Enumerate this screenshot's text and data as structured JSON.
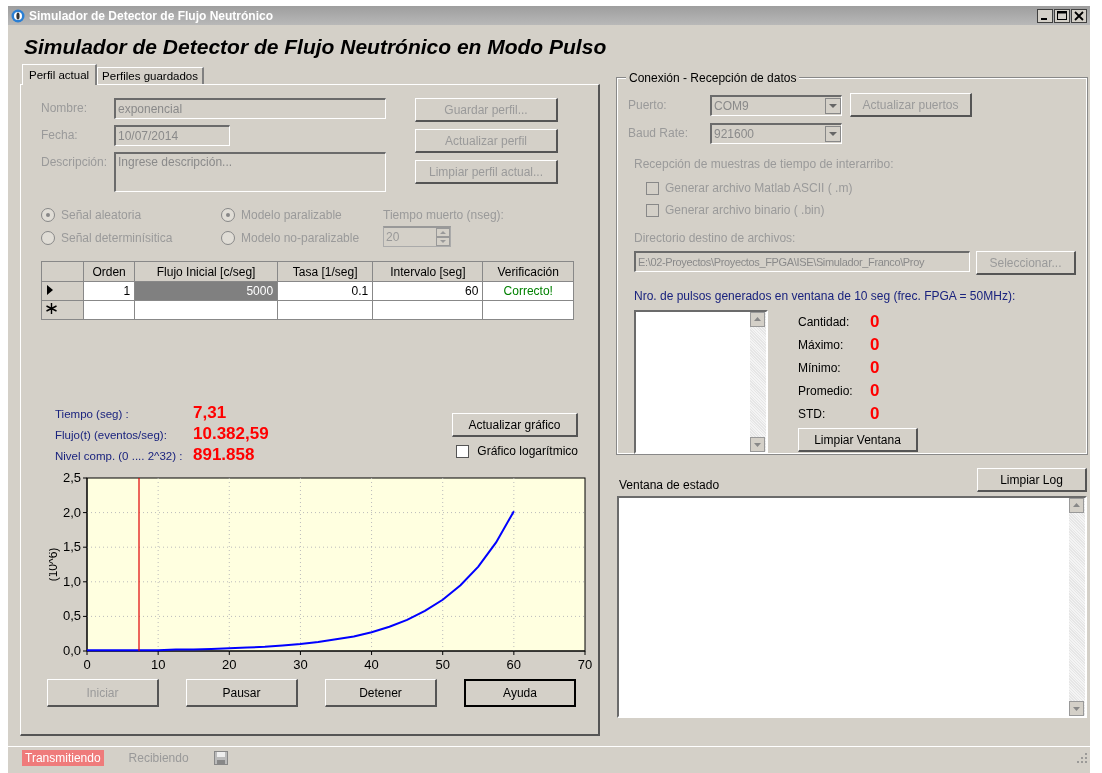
{
  "window": {
    "title": "Simulador de Detector de Flujo Neutrónico"
  },
  "heading": "Simulador de Detector de Flujo Neutrónico en Modo Pulso",
  "tabs": [
    {
      "label": "Perfil actual",
      "selected": true
    },
    {
      "label": "Perfiles guardados",
      "selected": false
    }
  ],
  "profile": {
    "disabled": true,
    "fields": [
      {
        "kind": "text",
        "label": "Nombre:",
        "value": "exponencial"
      },
      {
        "kind": "short",
        "label": "Fecha:",
        "value": "10/07/2014"
      },
      {
        "kind": "multiline",
        "label": "Descripción:",
        "placeholder": "Ingrese descripción..."
      }
    ],
    "buttons": [
      {
        "label": "Guardar perfil...",
        "disabled": true
      },
      {
        "label": "Actualizar perfil",
        "disabled": true
      },
      {
        "label": "Limpiar perfil actual...",
        "disabled": true
      }
    ]
  },
  "signal_options": [
    {
      "label": "Señal aleatoria",
      "selected": true,
      "disabled": true
    },
    {
      "label": "Señal determinísitica",
      "selected": false,
      "disabled": true
    }
  ],
  "model_options": [
    {
      "label": "Modelo paralizable",
      "selected": true,
      "disabled": true
    },
    {
      "label": "Modelo no-paralizable",
      "selected": false,
      "disabled": true
    }
  ],
  "dead_time": {
    "label": "Tiempo muerto (nseg):",
    "value": "20",
    "disabled": true
  },
  "table": {
    "columns": [
      "Orden",
      "Flujo Inicial [c/seg]",
      "Tasa [1/seg]",
      "Intervalo [seg]",
      "Verificación"
    ],
    "rows": [
      {
        "kind": "current",
        "cells": [
          {
            "text": "1",
            "selected": false
          },
          {
            "text": "5000",
            "selected": true
          },
          {
            "text": "0.1",
            "selected": false
          },
          {
            "text": "60",
            "selected": false
          },
          {
            "text": "Correcto!",
            "selected": false
          }
        ]
      },
      {
        "kind": "new",
        "cells": []
      }
    ]
  },
  "readouts": [
    {
      "label": "Tiempo (seg) :",
      "value": "7,31"
    },
    {
      "label": "Flujo(t) (eventos/seg):",
      "value": "10.382,59"
    },
    {
      "label": "Nivel comp. (0 .... 2^32) :",
      "value": "891.858"
    }
  ],
  "update_chart_button": {
    "label": "Actualizar gráfico"
  },
  "log_scale": {
    "label": "Gráfico logarítmico",
    "checked": false
  },
  "chart_data": {
    "type": "line",
    "ylabel": "(10^6)",
    "grid": true,
    "x": [
      0,
      2.5,
      5,
      7.5,
      10,
      12.5,
      15,
      17.5,
      20,
      22.5,
      25,
      27.5,
      30,
      32.5,
      35,
      37.5,
      40,
      42.5,
      45,
      47.5,
      50,
      52.5,
      55,
      57.5,
      60
    ],
    "series": [
      {
        "color": "#0000ff",
        "values": [
          0.01,
          0.01,
          0.01,
          0.01,
          0.01,
          0.02,
          0.02,
          0.03,
          0.04,
          0.05,
          0.06,
          0.08,
          0.1,
          0.13,
          0.17,
          0.21,
          0.27,
          0.35,
          0.45,
          0.58,
          0.74,
          0.95,
          1.22,
          1.57,
          2.02
        ]
      }
    ],
    "xlim": [
      0,
      70
    ],
    "ylim": [
      0,
      2.5
    ],
    "xticks": [
      0,
      10,
      20,
      30,
      40,
      50,
      60,
      70
    ],
    "yticks": [
      {
        "value": 0,
        "label": "0,0"
      },
      {
        "value": 0.5,
        "label": "0,5"
      },
      {
        "value": 1,
        "label": "1,0"
      },
      {
        "value": 1.5,
        "label": "1,5"
      },
      {
        "value": 2,
        "label": "2,0"
      },
      {
        "value": 2.5,
        "label": "2,5"
      }
    ],
    "ref_lines": [
      {
        "axis": "x",
        "value": 7.31,
        "color": "#e00000"
      }
    ]
  },
  "actions": [
    {
      "label": "Iniciar",
      "disabled": true,
      "default": false
    },
    {
      "label": "Pausar",
      "disabled": false,
      "default": false
    },
    {
      "label": "Detener",
      "disabled": false,
      "default": false
    },
    {
      "label": "Ayuda",
      "disabled": false,
      "default": true
    }
  ],
  "connection": {
    "title": "Conexión - Recepción de datos",
    "combos": [
      {
        "label": "Puerto:",
        "value": "COM9",
        "disabled": true
      },
      {
        "label": "Baud Rate:",
        "value": "921600",
        "disabled": true
      }
    ],
    "refresh_button": {
      "label": "Actualizar puertos",
      "disabled": true
    },
    "samples_label": "Recepción de muestras de tiempo de interarribo:",
    "file_options": [
      {
        "label": "Generar archivo Matlab ASCII ( .m)",
        "checked": false,
        "disabled": true
      },
      {
        "label": "Generar archivo binario ( .bin)",
        "checked": false,
        "disabled": true
      }
    ],
    "dir_label": "Directorio destino de archivos:",
    "dir_value": "E:\\02-Proyectos\\Proyectos_FPGA\\ISE\\Simulador_Franco\\Proy",
    "select_button": {
      "label": "Seleccionar...",
      "disabled": true
    },
    "pulses_label": "Nro. de pulsos generados en ventana de 10 seg (frec. FPGA = 50MHz):",
    "stats": [
      {
        "label": "Cantidad:",
        "value": "0"
      },
      {
        "label": "Máximo:",
        "value": "0"
      },
      {
        "label": "Mínimo:",
        "value": "0"
      },
      {
        "label": "Promedio:",
        "value": "0"
      },
      {
        "label": "STD:",
        "value": "0"
      }
    ],
    "clear_button": {
      "label": "Limpiar Ventana",
      "disabled": false
    }
  },
  "status_window": {
    "label": "Ventana de estado",
    "clear_button": {
      "label": "Limpiar Log",
      "disabled": false
    }
  },
  "status_bar": [
    {
      "label": "Transmitiendo",
      "active": true
    },
    {
      "label": "Recibiendo",
      "active": false
    }
  ]
}
